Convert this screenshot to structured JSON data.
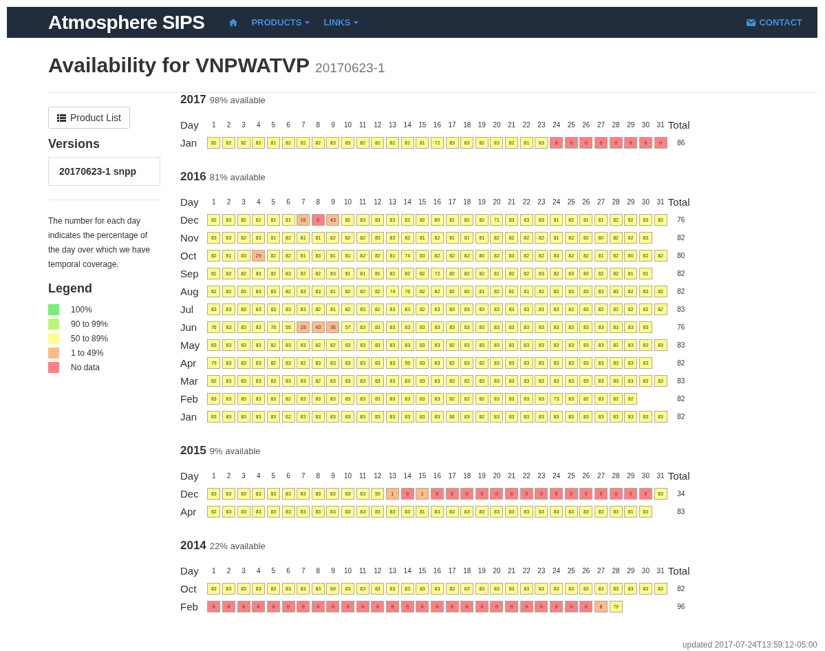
{
  "navbar": {
    "brand": "Atmosphere SIPS",
    "menus": [
      {
        "label": "PRODUCTS"
      },
      {
        "label": "LINKS"
      }
    ],
    "contact": "CONTACT"
  },
  "title": {
    "text": "Availability for VNPWATVP",
    "version": "20170623-1"
  },
  "sidebar": {
    "product_list_button": "Product List",
    "versions_heading": "Versions",
    "versions": [
      {
        "label": "20170623-1 snpp"
      }
    ],
    "note": "The number for each day indicates the percentage of the day over which we have temporal coverage.",
    "legend_heading": "Legend",
    "legend": [
      {
        "label": "100%",
        "color": "#77ee77"
      },
      {
        "label": "90 to 99%",
        "color": "#bbf57a"
      },
      {
        "label": "50 to 89%",
        "color": "#ffff88"
      },
      {
        "label": "1 to 49%",
        "color": "#ffbb88"
      },
      {
        "label": "No data",
        "color": "#ff8080"
      }
    ]
  },
  "years": [
    {
      "year": "2017",
      "available": "98% available",
      "header": [
        "Day",
        "1",
        "2",
        "3",
        "4",
        "5",
        "6",
        "7",
        "8",
        "9",
        "10",
        "11",
        "12",
        "13",
        "14",
        "15",
        "16",
        "17",
        "18",
        "19",
        "20",
        "21",
        "22",
        "23",
        "24",
        "25",
        "26",
        "27",
        "28",
        "29",
        "30",
        "31",
        "Total"
      ],
      "months": [
        {
          "label": "Jan",
          "total": "86",
          "days": [
            "82",
            "82",
            "82",
            "82",
            "81",
            "82",
            "82",
            "82",
            "83",
            "83",
            "82",
            "82",
            "82",
            "81",
            "81",
            "72",
            "83",
            "83",
            "82",
            "83",
            "82",
            "81",
            "83",
            "0",
            "0",
            "0",
            "0",
            "0",
            "0",
            "0",
            "0"
          ]
        }
      ]
    },
    {
      "year": "2016",
      "available": "81% available",
      "header": [
        "Day",
        "1",
        "2",
        "3",
        "4",
        "5",
        "6",
        "7",
        "8",
        "9",
        "10",
        "11",
        "12",
        "13",
        "14",
        "15",
        "16",
        "17",
        "18",
        "19",
        "20",
        "21",
        "22",
        "23",
        "24",
        "25",
        "26",
        "27",
        "28",
        "29",
        "30",
        "31",
        "Total"
      ],
      "months": [
        {
          "label": "Dec",
          "total": "76",
          "days": [
            "82",
            "83",
            "82",
            "82",
            "81",
            "81",
            "16",
            "0",
            "43",
            "82",
            "83",
            "83",
            "83",
            "81",
            "82",
            "80",
            "81",
            "82",
            "82",
            "71",
            "83",
            "83",
            "83",
            "81",
            "82",
            "81",
            "81",
            "82",
            "82",
            "83",
            "82"
          ]
        },
        {
          "label": "Nov",
          "total": "82",
          "days": [
            "83",
            "83",
            "82",
            "83",
            "81",
            "82",
            "81",
            "81",
            "82",
            "82",
            "82",
            "83",
            "83",
            "82",
            "81",
            "82",
            "81",
            "81",
            "81",
            "82",
            "82",
            "82",
            "82",
            "81",
            "82",
            "82",
            "80",
            "82",
            "82",
            "83"
          ]
        },
        {
          "label": "Oct",
          "total": "80",
          "days": [
            "82",
            "81",
            "83",
            "29",
            "82",
            "82",
            "81",
            "83",
            "81",
            "81",
            "82",
            "82",
            "81",
            "74",
            "83",
            "82",
            "82",
            "82",
            "80",
            "82",
            "83",
            "82",
            "82",
            "83",
            "82",
            "82",
            "81",
            "82",
            "80",
            "82",
            "82"
          ]
        },
        {
          "label": "Sep",
          "total": "82",
          "days": [
            "81",
            "82",
            "82",
            "83",
            "82",
            "83",
            "82",
            "82",
            "83",
            "81",
            "81",
            "81",
            "82",
            "82",
            "82",
            "72",
            "82",
            "82",
            "82",
            "81",
            "82",
            "82",
            "83",
            "82",
            "83",
            "83",
            "82",
            "82",
            "81",
            "81"
          ]
        },
        {
          "label": "Aug",
          "total": "82",
          "days": [
            "82",
            "82",
            "83",
            "83",
            "83",
            "82",
            "83",
            "83",
            "81",
            "82",
            "82",
            "82",
            "74",
            "76",
            "82",
            "82",
            "82",
            "82",
            "81",
            "82",
            "81",
            "81",
            "82",
            "82",
            "83",
            "83",
            "83",
            "83",
            "82",
            "83",
            "82"
          ]
        },
        {
          "label": "Jul",
          "total": "83",
          "days": [
            "83",
            "83",
            "83",
            "83",
            "83",
            "83",
            "83",
            "82",
            "81",
            "82",
            "83",
            "82",
            "83",
            "83",
            "82",
            "83",
            "83",
            "83",
            "83",
            "83",
            "83",
            "83",
            "83",
            "83",
            "82",
            "83",
            "82",
            "82",
            "82",
            "82",
            "82"
          ]
        },
        {
          "label": "Jun",
          "total": "76",
          "days": [
            "76",
            "83",
            "83",
            "83",
            "78",
            "55",
            "25",
            "43",
            "36",
            "57",
            "83",
            "83",
            "83",
            "83",
            "83",
            "83",
            "83",
            "83",
            "83",
            "83",
            "83",
            "83",
            "83",
            "83",
            "83",
            "83",
            "83",
            "83",
            "83",
            "83"
          ]
        },
        {
          "label": "May",
          "total": "83",
          "days": [
            "83",
            "83",
            "83",
            "83",
            "82",
            "83",
            "83",
            "82",
            "82",
            "83",
            "83",
            "83",
            "83",
            "83",
            "83",
            "83",
            "82",
            "83",
            "83",
            "83",
            "83",
            "83",
            "83",
            "83",
            "83",
            "83",
            "83",
            "82",
            "83",
            "83",
            "83"
          ]
        },
        {
          "label": "Apr",
          "total": "82",
          "days": [
            "79",
            "83",
            "83",
            "83",
            "82",
            "83",
            "82",
            "83",
            "83",
            "83",
            "83",
            "83",
            "83",
            "55",
            "83",
            "83",
            "82",
            "83",
            "82",
            "83",
            "83",
            "83",
            "83",
            "83",
            "83",
            "83",
            "83",
            "83",
            "83",
            "83"
          ]
        },
        {
          "label": "Mar",
          "total": "83",
          "days": [
            "82",
            "83",
            "83",
            "83",
            "83",
            "83",
            "83",
            "82",
            "83",
            "83",
            "83",
            "83",
            "83",
            "83",
            "83",
            "83",
            "83",
            "82",
            "83",
            "83",
            "83",
            "83",
            "83",
            "83",
            "83",
            "83",
            "83",
            "83",
            "83",
            "83",
            "83"
          ]
        },
        {
          "label": "Feb",
          "total": "82",
          "days": [
            "83",
            "83",
            "83",
            "83",
            "83",
            "82",
            "83",
            "83",
            "83",
            "83",
            "83",
            "83",
            "83",
            "83",
            "83",
            "83",
            "82",
            "82",
            "82",
            "83",
            "83",
            "83",
            "83",
            "73",
            "83",
            "82",
            "83",
            "82",
            "82"
          ]
        },
        {
          "label": "Jan",
          "total": "82",
          "days": [
            "83",
            "83",
            "83",
            "83",
            "83",
            "62",
            "83",
            "83",
            "83",
            "83",
            "83",
            "83",
            "83",
            "83",
            "83",
            "83",
            "66",
            "83",
            "82",
            "83",
            "83",
            "83",
            "83",
            "83",
            "83",
            "83",
            "83",
            "83",
            "83",
            "83",
            "83"
          ]
        }
      ]
    },
    {
      "year": "2015",
      "available": "9% available",
      "header": [
        "Day",
        "1",
        "2",
        "3",
        "4",
        "5",
        "6",
        "7",
        "8",
        "9",
        "10",
        "11",
        "12",
        "13",
        "14",
        "15",
        "16",
        "17",
        "18",
        "19",
        "20",
        "21",
        "22",
        "23",
        "24",
        "25",
        "26",
        "27",
        "28",
        "29",
        "30",
        "31",
        "Total"
      ],
      "months": [
        {
          "label": "Dec",
          "total": "34",
          "days": [
            "83",
            "83",
            "83",
            "83",
            "83",
            "83",
            "83",
            "83",
            "83",
            "83",
            "83",
            "59",
            "1",
            "0",
            "1",
            "0",
            "0",
            "0",
            "0",
            "0",
            "0",
            "0",
            "0",
            "0",
            "0",
            "0",
            "0",
            "0",
            "0",
            "0",
            "83"
          ]
        },
        {
          "label": "Apr",
          "total": "83",
          "days": [
            "82",
            "83",
            "83",
            "83",
            "83",
            "83",
            "83",
            "83",
            "83",
            "83",
            "83",
            "83",
            "83",
            "83",
            "81",
            "83",
            "83",
            "83",
            "83",
            "83",
            "83",
            "83",
            "83",
            "83",
            "83",
            "83",
            "83",
            "83",
            "81",
            "83"
          ]
        }
      ]
    },
    {
      "year": "2014",
      "available": "22% available",
      "header": [
        "Day",
        "1",
        "2",
        "3",
        "4",
        "5",
        "6",
        "7",
        "8",
        "9",
        "10",
        "11",
        "12",
        "13",
        "14",
        "15",
        "16",
        "17",
        "18",
        "19",
        "20",
        "21",
        "22",
        "23",
        "24",
        "25",
        "26",
        "27",
        "28",
        "29",
        "30",
        "31",
        "Total"
      ],
      "months": [
        {
          "label": "Oct",
          "total": "82",
          "days": [
            "83",
            "83",
            "83",
            "83",
            "83",
            "83",
            "83",
            "83",
            "69",
            "83",
            "83",
            "83",
            "83",
            "83",
            "83",
            "83",
            "83",
            "83",
            "83",
            "83",
            "83",
            "83",
            "83",
            "83",
            "83",
            "83",
            "83",
            "83",
            "83",
            "83",
            "83"
          ]
        },
        {
          "label": "Feb",
          "total": "96",
          "days": [
            "0",
            "0",
            "0",
            "0",
            "0",
            "0",
            "0",
            "0",
            "0",
            "0",
            "0",
            "0",
            "0",
            "0",
            "0",
            "0",
            "0",
            "0",
            "0",
            "0",
            "0",
            "0",
            "0",
            "0",
            "0",
            "0",
            "8",
            "79"
          ]
        }
      ]
    }
  ],
  "footer": {
    "updated": "updated 2017-07-24T13:59:12-05:00"
  }
}
